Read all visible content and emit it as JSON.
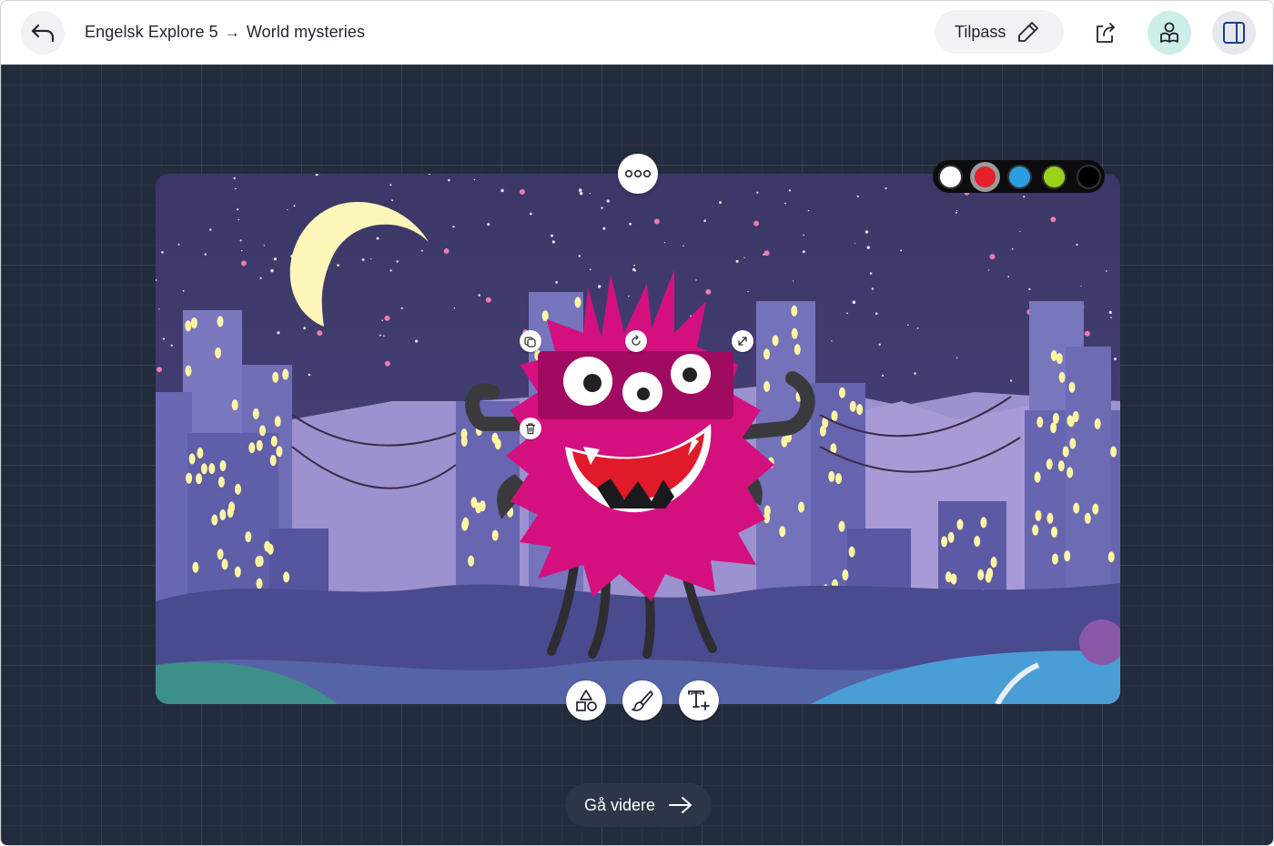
{
  "header": {
    "breadcrumb": {
      "course": "Engelsk Explore 5",
      "separator": "→",
      "page": "World mysteries"
    },
    "tilpass_label": "Tilpass",
    "icons": {
      "back": "back-arrow-icon",
      "edit": "pencil-icon",
      "share": "share-icon",
      "profile": "reader-profile-icon",
      "panel": "sidebar-panel-icon"
    }
  },
  "canvas": {
    "more_menu_icon": "more-dots-icon",
    "color_palette": {
      "colors": [
        "#ffffff",
        "#e5202a",
        "#2b9ee0",
        "#9ad21a",
        "#000000"
      ],
      "selected_index": 1
    },
    "selection_handles": [
      "copy-icon",
      "rotate-icon",
      "resize-icon",
      "trash-icon"
    ],
    "tools": [
      "shapes-icon",
      "brush-icon",
      "add-text-icon"
    ],
    "scene_colors": {
      "sky": "#3d3868",
      "monster": "#d4107f",
      "moon": "#fdf6b9",
      "window_light": "#fff6a3"
    }
  },
  "footer": {
    "continue_label": "Gå videre"
  }
}
